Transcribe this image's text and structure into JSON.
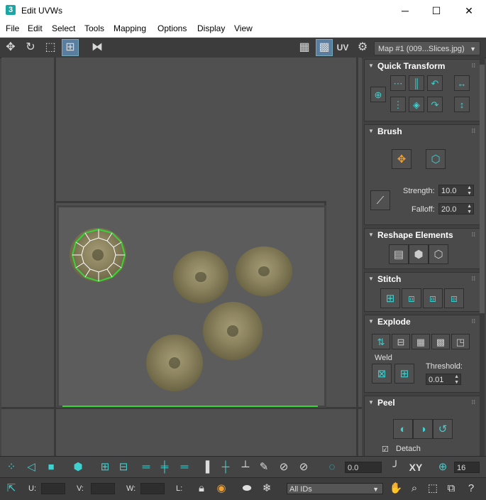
{
  "window": {
    "app_icon": "3",
    "title": "Edit UVWs",
    "minimize": "─",
    "maximize": "☐",
    "close": "✕"
  },
  "menu": [
    "File",
    "Edit",
    "Select",
    "Tools",
    "Mapping",
    "Options",
    "Display",
    "View"
  ],
  "toolbar": {
    "uv_label": "UV",
    "map_select": "Map #1 (009...Slices.jpg)"
  },
  "quick_transform": {
    "title": "Quick Transform"
  },
  "brush": {
    "title": "Brush",
    "strength_label": "Strength:",
    "strength_value": "10.0",
    "falloff_label": "Falloff:",
    "falloff_value": "20.0"
  },
  "reshape": {
    "title": "Reshape Elements"
  },
  "stitch": {
    "title": "Stitch"
  },
  "explode": {
    "title": "Explode",
    "weld_label": "Weld",
    "threshold_label": "Threshold:",
    "threshold_value": "0.01"
  },
  "peel": {
    "title": "Peel",
    "detach_label": "Detach"
  },
  "bottom": {
    "spinner_value": "0.0",
    "xy_label": "XY",
    "grid_value": "16"
  },
  "status": {
    "u_label": "U:",
    "v_label": "V:",
    "w_label": "W:",
    "l_label": "L:",
    "ids_select": "All IDs"
  },
  "colors": {
    "accent": "#3fd0d0",
    "selection": "#3bd13b"
  }
}
